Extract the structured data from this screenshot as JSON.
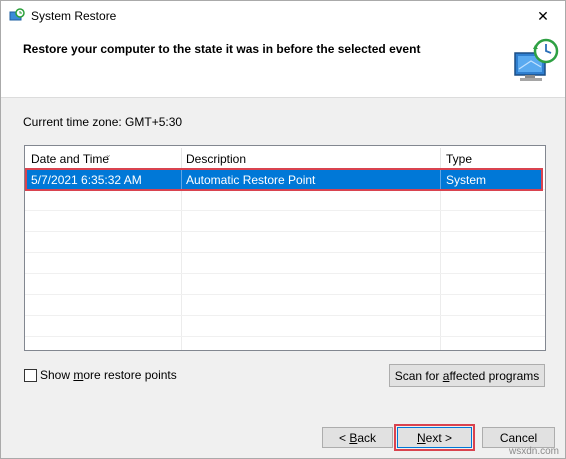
{
  "window": {
    "title": "System Restore",
    "icon": "system-restore-icon",
    "close_glyph": "✕"
  },
  "header": {
    "heading": "Restore your computer to the state it was in before the selected event",
    "icon": "system-restore-clock-computer-icon"
  },
  "timezone": "Current time zone: GMT+5:30",
  "table": {
    "columns": [
      "Date and Time",
      "Description",
      "Type"
    ],
    "sort_glyph": "⌄",
    "rows": [
      {
        "date": "5/7/2021 6:35:32 AM",
        "description": "Automatic Restore Point",
        "type": "System",
        "selected": true
      }
    ]
  },
  "show_more": {
    "prefix": "Show ",
    "accel": "m",
    "suffix": "ore restore points",
    "checked": false
  },
  "scan_button": {
    "prefix": "Scan for ",
    "accel": "a",
    "suffix": "ffected programs"
  },
  "back_button": {
    "prefix": "< ",
    "accel": "B",
    "suffix": "ack"
  },
  "next_button": {
    "prefix": "",
    "accel": "N",
    "suffix": "ext >"
  },
  "cancel_button": "Cancel",
  "watermark": "wsxdn.com",
  "colors": {
    "selection": "#0078d7",
    "highlight_box": "#d9434f"
  }
}
